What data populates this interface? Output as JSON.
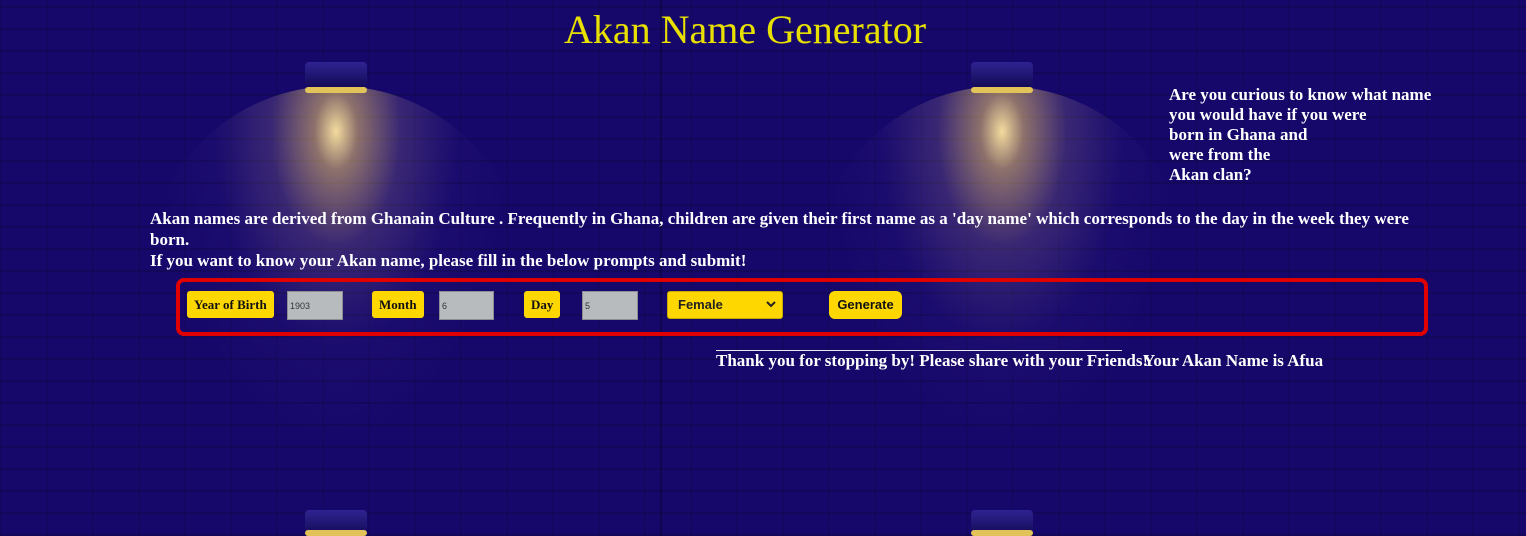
{
  "title": "Akan Name Generator",
  "curious_lines": [
    "Are you curious to know what name",
    "you would have if you were",
    "born in Ghana and",
    "were from the",
    "Akan clan?"
  ],
  "intro_lines": [
    "Akan names are derived from Ghanain Culture . Frequently in Ghana, children are given their first name as a 'day name' which corresponds to the day in the week they were born.",
    "If you want to know your Akan name, please fill in the below prompts and submit!"
  ],
  "form": {
    "year_label": "Year of Birth",
    "year_value": "1903",
    "month_label": "Month",
    "month_value": "6",
    "day_label": "Day",
    "day_value": "5",
    "gender_selected": "Female",
    "generate_label": "Generate"
  },
  "thanks_text": "Thank you for stopping by! Please share with your Friends!",
  "result_text": "Your Akan Name is Afua",
  "colors": {
    "background": "#16086a",
    "title": "#e8e000",
    "accent": "#ffd700",
    "form_border": "#e00000",
    "input_bg": "#b7bbbe",
    "text": "#ffffff"
  },
  "icons": {
    "select_caret": "chevron-down-icon"
  }
}
